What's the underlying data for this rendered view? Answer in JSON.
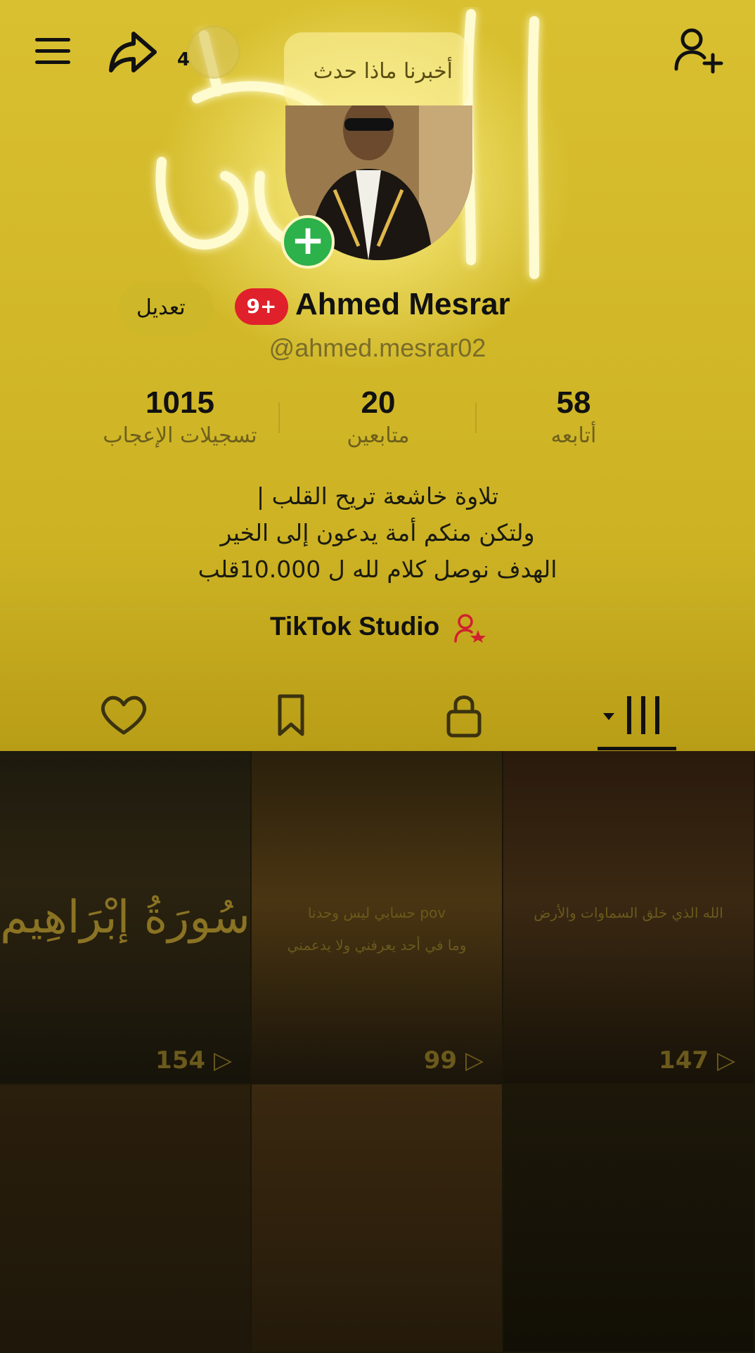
{
  "header": {
    "share_count": "4",
    "status_prompt": "أخبرنا ماذا حدث"
  },
  "profile": {
    "edit_label": "تعديل",
    "badge": "9+",
    "display_name": "Ahmed Mesrar",
    "username": "@ahmed.mesrar02"
  },
  "stats": {
    "likes": {
      "value": "1015",
      "label": "تسجيلات الإعجاب"
    },
    "followers": {
      "value": "20",
      "label": "متابعين"
    },
    "following": {
      "value": "58",
      "label": "أتابعه"
    }
  },
  "bio": {
    "line1": "تلاوة خاشعة تريح القلب |",
    "line2": "ولتكن منكم أمة يدعون إلى الخير",
    "line3": "الهدف نوصل كلام لله ل 10.000قلب"
  },
  "studio": {
    "label": "TikTok Studio"
  },
  "tabs": [
    "videos-tab",
    "private-tab",
    "favorites-tab",
    "liked-tab"
  ],
  "videos": [
    {
      "views": "154",
      "calligraphy": "سُورَةُ إبْرَاهِيم"
    },
    {
      "views": "99",
      "overlay_line1": "pov حسابي ليس وحدنا",
      "overlay_line2": "وما في أحد يعرفني ولا يدعمني"
    },
    {
      "views": "147",
      "overlay_line1": "الله الذي خلق السماوات والأرض"
    },
    {
      "views": ""
    },
    {
      "views": ""
    },
    {
      "views": ""
    }
  ],
  "colors": {
    "accent_red": "#e0202a",
    "add_green": "#2db14a",
    "background": "#cdb324"
  }
}
